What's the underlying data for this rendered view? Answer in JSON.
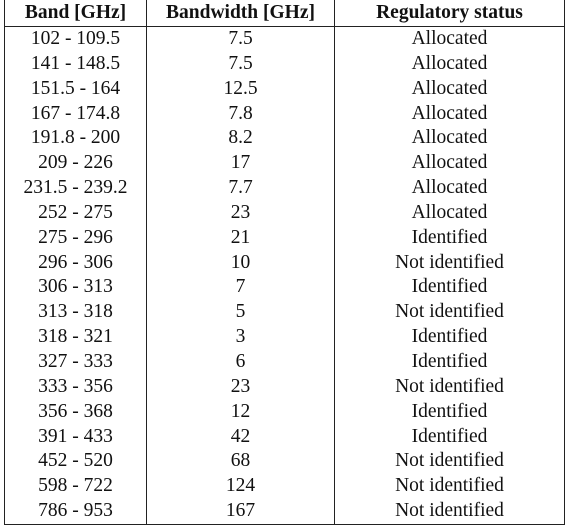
{
  "table": {
    "headers": [
      "Band [GHz]",
      "Bandwidth [GHz]",
      "Regulatory status"
    ],
    "rows": [
      [
        "102 - 109.5",
        "7.5",
        "Allocated"
      ],
      [
        "141 - 148.5",
        "7.5",
        "Allocated"
      ],
      [
        "151.5 - 164",
        "12.5",
        "Allocated"
      ],
      [
        "167 - 174.8",
        "7.8",
        "Allocated"
      ],
      [
        "191.8 - 200",
        "8.2",
        "Allocated"
      ],
      [
        "209 - 226",
        "17",
        "Allocated"
      ],
      [
        "231.5 - 239.2",
        "7.7",
        "Allocated"
      ],
      [
        "252 - 275",
        "23",
        "Allocated"
      ],
      [
        "275 - 296",
        "21",
        "Identified"
      ],
      [
        "296 - 306",
        "10",
        "Not identified"
      ],
      [
        "306 - 313",
        "7",
        "Identified"
      ],
      [
        "313 - 318",
        "5",
        "Not identified"
      ],
      [
        "318 - 321",
        "3",
        "Identified"
      ],
      [
        "327 - 333",
        "6",
        "Identified"
      ],
      [
        "333 - 356",
        "23",
        "Not identified"
      ],
      [
        "356 - 368",
        "12",
        "Identified"
      ],
      [
        "391 - 433",
        "42",
        "Identified"
      ],
      [
        "452 - 520",
        "68",
        "Not identified"
      ],
      [
        "598 - 722",
        "124",
        "Not identified"
      ],
      [
        "786 - 953",
        "167",
        "Not identified"
      ]
    ]
  }
}
